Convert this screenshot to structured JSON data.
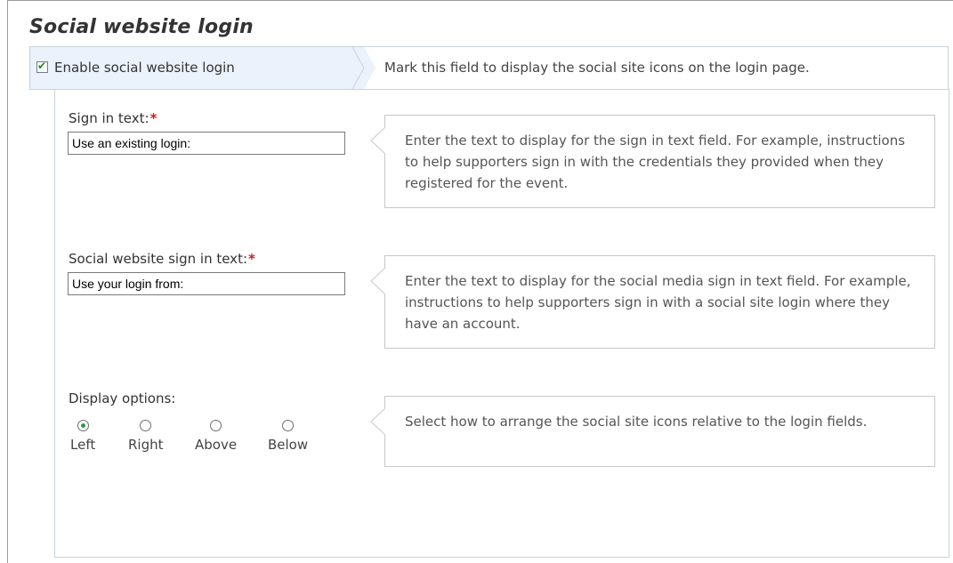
{
  "title": "Social website login",
  "enable": {
    "checked": true,
    "label": "Enable social website login",
    "help": "Mark this field to display the social site icons on the login page."
  },
  "sign_in": {
    "label": "Sign in text:",
    "required_mark": "*",
    "value": "Use an existing login:",
    "help": "Enter the text to display for the sign in text field. For example, instructions to help supporters sign in with the credentials they provided when they registered for the event."
  },
  "social_sign_in": {
    "label": "Social website sign in text:",
    "required_mark": "*",
    "value": "Use your login from:",
    "help": "Enter the text to display for the social media sign in text field. For example, instructions to help supporters sign in with a social site login where they have an account."
  },
  "display_options": {
    "label": "Display options:",
    "options": [
      "Left",
      "Right",
      "Above",
      "Below"
    ],
    "selected": "Left",
    "help": "Select how to arrange the social site icons relative to the login fields."
  },
  "colors": {
    "accent_bg": "#ebf2fb",
    "required": "#cc1e1e",
    "radio_selected": "#2e9a4a"
  }
}
